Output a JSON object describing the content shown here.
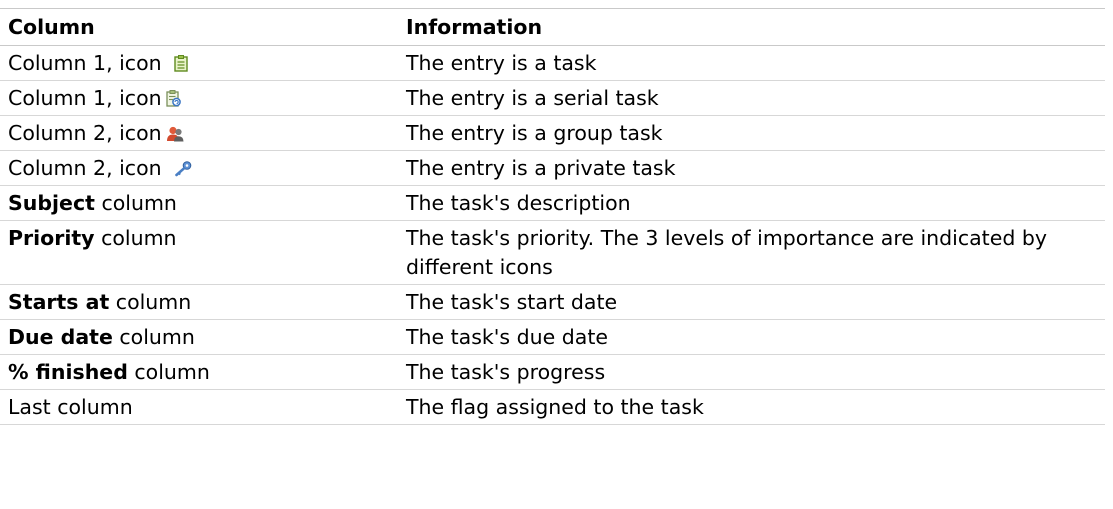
{
  "table": {
    "headers": {
      "column": "Column",
      "information": "Information"
    },
    "rows": [
      {
        "column_text": "Column 1, icon",
        "icon": "task-icon",
        "information": "The entry is a task"
      },
      {
        "column_text": "Column 1, icon",
        "icon": "serial-task-icon",
        "information": "The entry is a serial task"
      },
      {
        "column_text": "Column 2, icon",
        "icon": "group-task-icon",
        "information": "The entry is a group task"
      },
      {
        "column_text": "Column 2, icon",
        "icon": "private-task-icon",
        "information": "The entry is a private task"
      },
      {
        "column_bold": "Subject",
        "column_text": " column",
        "information": "The task's description"
      },
      {
        "column_bold": "Priority",
        "column_text": " column",
        "information": "The task's priority. The 3 levels of importance are indicated by different icons"
      },
      {
        "column_bold": "Starts at",
        "column_text": " column",
        "information": "The task's start date"
      },
      {
        "column_bold": "Due date",
        "column_text": " column",
        "information": "The task's due date"
      },
      {
        "column_bold": "% finished",
        "column_text": " column",
        "information": "The task's progress"
      },
      {
        "column_text": "Last column",
        "information": "The flag assigned to the task"
      }
    ]
  }
}
